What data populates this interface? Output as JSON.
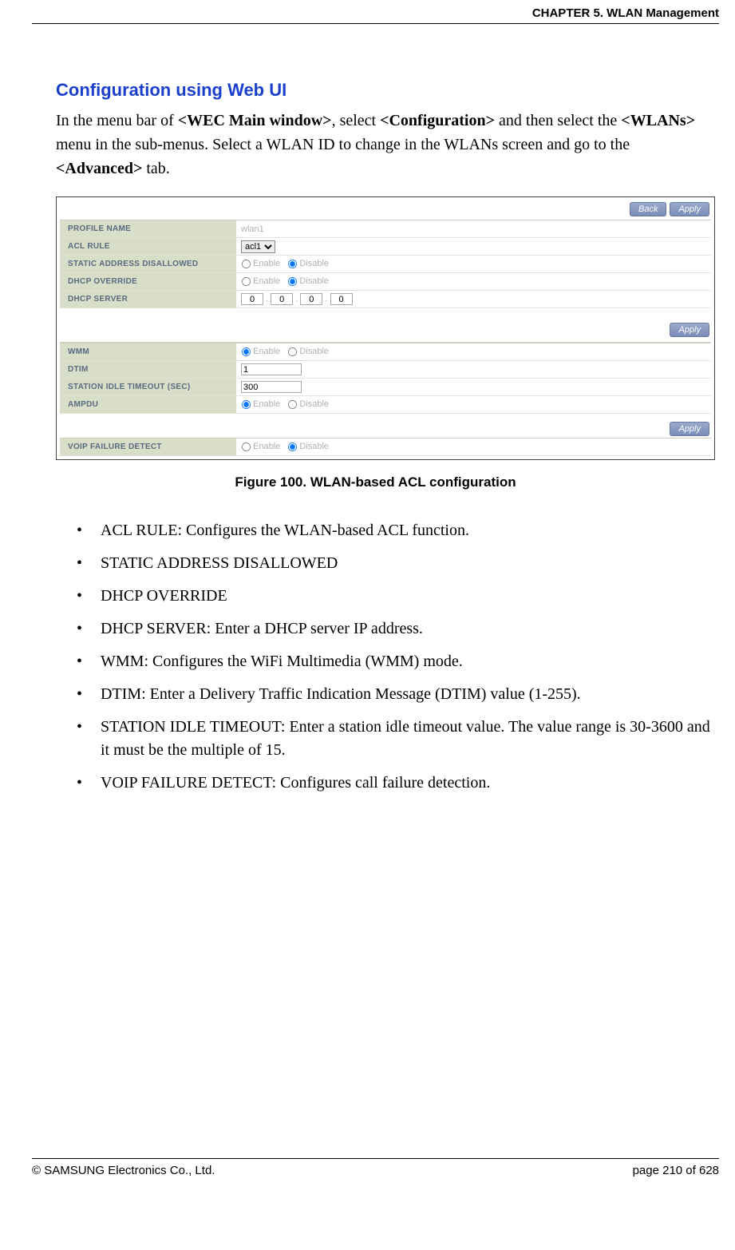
{
  "header": "CHAPTER 5. WLAN Management",
  "section_title": "Configuration using Web UI",
  "intro": {
    "t1": "In the menu bar of ",
    "b1": "<WEC Main window>",
    "t2": ", select ",
    "b2": "<Configuration>",
    "t3": " and then select the ",
    "b3": "<WLANs>",
    "t4": " menu in the sub-menus. Select a WLAN ID to change in the WLANs screen and go to the ",
    "b4": "<Advanced>",
    "t5": " tab."
  },
  "figure": {
    "buttons": {
      "back": "Back",
      "apply": "Apply"
    },
    "rows1": [
      {
        "label": "PROFILE NAME",
        "value_text": "wlan1"
      },
      {
        "label": "ACL RULE",
        "select_value": "acl1"
      },
      {
        "label": "STATIC ADDRESS DISALLOWED",
        "radio": {
          "enable": "Enable",
          "disable": "Disable",
          "selected": "disable"
        }
      },
      {
        "label": "DHCP OVERRIDE",
        "radio": {
          "enable": "Enable",
          "disable": "Disable",
          "selected": "disable"
        }
      },
      {
        "label": "DHCP SERVER",
        "ip": [
          "0",
          "0",
          "0",
          "0"
        ]
      }
    ],
    "rows2": [
      {
        "label": "WMM",
        "radio": {
          "enable": "Enable",
          "disable": "Disable",
          "selected": "enable"
        }
      },
      {
        "label": "DTIM",
        "input_value": "1"
      },
      {
        "label": "STATION IDLE TIMEOUT (SEC)",
        "input_value": "300"
      },
      {
        "label": "AMPDU",
        "radio": {
          "enable": "Enable",
          "disable": "Disable",
          "selected": "enable"
        }
      }
    ],
    "rows3": [
      {
        "label": "VOIP FAILURE DETECT",
        "radio": {
          "enable": "Enable",
          "disable": "Disable",
          "selected": "disable"
        }
      }
    ]
  },
  "caption": "Figure 100. WLAN-based ACL configuration",
  "bullets": [
    "ACL RULE: Configures the WLAN-based ACL function.",
    "STATIC ADDRESS DISALLOWED",
    "DHCP OVERRIDE",
    "DHCP SERVER: Enter a DHCP server IP address.",
    "WMM: Configures the WiFi Multimedia (WMM) mode.",
    "DTIM: Enter a Delivery Traffic Indication Message (DTIM) value (1-255).",
    "STATION IDLE TIMEOUT: Enter a station idle timeout value. The value range is 30-3600 and it must be the multiple of 15.",
    "VOIP FAILURE DETECT: Configures call failure detection."
  ],
  "footer": {
    "left": "© SAMSUNG Electronics Co., Ltd.",
    "right": "page 210 of 628"
  }
}
